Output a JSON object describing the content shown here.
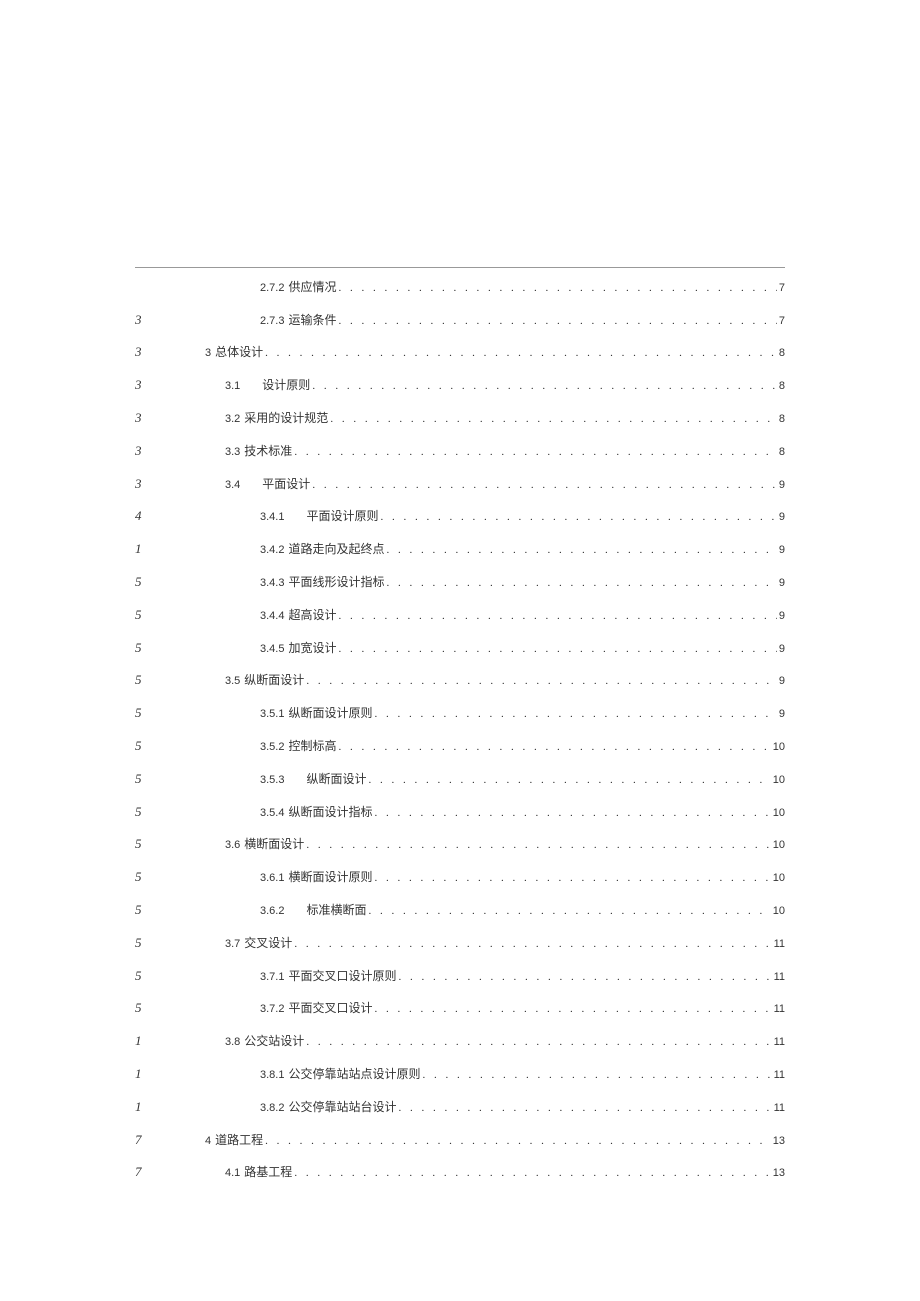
{
  "toc": [
    {
      "left": "",
      "indent": "indent-3",
      "num": "2.7.2",
      "numStyle": "section-num",
      "title": "供应情况",
      "page": "7"
    },
    {
      "left": "3",
      "indent": "indent-3",
      "num": "2.7.3",
      "numStyle": "section-num",
      "title": "运输条件",
      "page": "7"
    },
    {
      "left": "3",
      "indent": "indent-1",
      "num": "3",
      "numStyle": "section-num",
      "title": "总体设计",
      "page": "8"
    },
    {
      "left": "3",
      "indent": "indent-2",
      "num": "3.1",
      "numStyle": "section-num-spaced",
      "title": "设计原则",
      "page": "8"
    },
    {
      "left": "3",
      "indent": "indent-2",
      "num": "3.2",
      "numStyle": "section-num",
      "title": "采用的设计规范",
      "page": "8"
    },
    {
      "left": "3",
      "indent": "indent-2",
      "num": "3.3",
      "numStyle": "section-num",
      "title": "技术标准",
      "page": "8"
    },
    {
      "left": "3",
      "indent": "indent-2",
      "num": "3.4",
      "numStyle": "section-num-spaced",
      "title": "平面设计",
      "page": "9"
    },
    {
      "left": "4",
      "indent": "indent-3",
      "num": "3.4.1",
      "numStyle": "section-num-spaced",
      "title": "平面设计原则",
      "page": "9"
    },
    {
      "left": "1",
      "indent": "indent-3",
      "num": "3.4.2",
      "numStyle": "section-num",
      "title": "道路走向及起终点",
      "page": "9"
    },
    {
      "left": "5",
      "indent": "indent-3",
      "num": "3.4.3",
      "numStyle": "section-num",
      "title": "平面线形设计指标",
      "page": "9"
    },
    {
      "left": "5",
      "indent": "indent-3",
      "num": "3.4.4",
      "numStyle": "section-num",
      "title": "超高设计",
      "page": "9"
    },
    {
      "left": "5",
      "indent": "indent-3",
      "num": "3.4.5",
      "numStyle": "section-num",
      "title": "加宽设计",
      "page": "9"
    },
    {
      "left": "5",
      "indent": "indent-2",
      "num": "3.5",
      "numStyle": "section-num",
      "title": "纵断面设计",
      "page": "9"
    },
    {
      "left": "5",
      "indent": "indent-3",
      "num": "3.5.1",
      "numStyle": "section-num",
      "title": "纵断面设计原则",
      "page": "9"
    },
    {
      "left": "5",
      "indent": "indent-3",
      "num": "3.5.2",
      "numStyle": "section-num",
      "title": "控制标高",
      "page": "10"
    },
    {
      "left": "5",
      "indent": "indent-3",
      "num": "3.5.3",
      "numStyle": "section-num-spaced",
      "title": "纵断面设计",
      "page": "10"
    },
    {
      "left": "5",
      "indent": "indent-3",
      "num": "3.5.4",
      "numStyle": "section-num",
      "title": "纵断面设计指标",
      "page": "10"
    },
    {
      "left": "5",
      "indent": "indent-2",
      "num": "3.6",
      "numStyle": "section-num",
      "title": "横断面设计",
      "page": "10"
    },
    {
      "left": "5",
      "indent": "indent-3",
      "num": "3.6.1",
      "numStyle": "section-num",
      "title": "横断面设计原则",
      "page": "10"
    },
    {
      "left": "5",
      "indent": "indent-3",
      "num": "3.6.2",
      "numStyle": "section-num-spaced",
      "title": "标准横断面",
      "page": "10"
    },
    {
      "left": "5",
      "indent": "indent-2",
      "num": "3.7",
      "numStyle": "section-num",
      "title": "交叉设计",
      "page": "11"
    },
    {
      "left": "5",
      "indent": "indent-3",
      "num": "3.7.1",
      "numStyle": "section-num",
      "title": "平面交叉口设计原则",
      "page": "11"
    },
    {
      "left": "5",
      "indent": "indent-3",
      "num": "3.7.2",
      "numStyle": "section-num",
      "title": "平面交叉口设计",
      "page": "11"
    },
    {
      "left": "1",
      "indent": "indent-2",
      "num": "3.8",
      "numStyle": "section-num",
      "title": "公交站设计",
      "page": "11"
    },
    {
      "left": "1",
      "indent": "indent-3",
      "num": "3.8.1",
      "numStyle": "section-num",
      "title": "公交停靠站站点设计原则",
      "page": "11"
    },
    {
      "left": "1",
      "indent": "indent-3",
      "num": "3.8.2",
      "numStyle": "section-num",
      "title": "公交停靠站站台设计",
      "page": "11"
    },
    {
      "left": "7",
      "indent": "indent-1",
      "num": "4",
      "numStyle": "section-num",
      "title": "道路工程",
      "page": "13"
    },
    {
      "left": "7",
      "indent": "indent-2",
      "num": "4.1",
      "numStyle": "section-num",
      "title": "路基工程",
      "page": "13"
    }
  ],
  "dots": ". . . . . . . . . . . . . . . . . . . . . . . . . . . . . . . . . . . . . . . . . . . . . . . . . . . . . . . . . . . . . . . . . . . . . . . . . . . . . . . . . . . . . . . . . . . . . . . . . . . . . . . . . . . . . . . . . . . . . . . ."
}
